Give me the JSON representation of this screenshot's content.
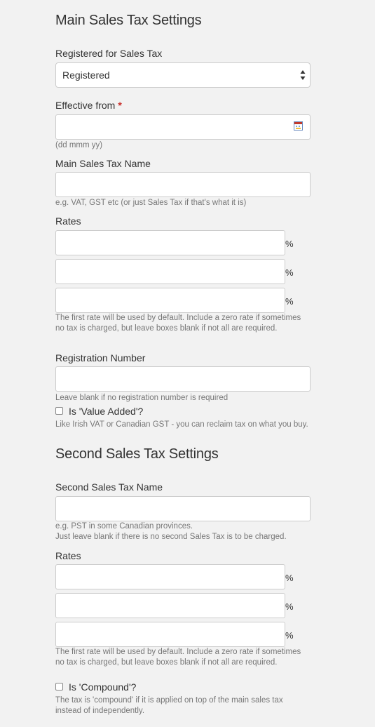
{
  "main": {
    "title": "Main Sales Tax Settings",
    "registered_label": "Registered for Sales Tax",
    "registered_value": "Registered",
    "effective_label": "Effective from",
    "effective_required": "*",
    "effective_value": "",
    "effective_help": "(dd mmm yy)",
    "name_label": "Main Sales Tax Name",
    "name_value": "",
    "name_help": "e.g. VAT, GST etc (or just Sales Tax if that's what it is)",
    "rates_label": "Rates",
    "rates": [
      "",
      "",
      ""
    ],
    "rate_unit": "%",
    "rates_help": "The first rate will be used by default. Include a zero rate if sometimes no tax is charged, but leave boxes blank if not all are required.",
    "regno_label": "Registration Number",
    "regno_value": "",
    "regno_help": "Leave blank if no registration number is required",
    "value_added_label": "Is 'Value Added'?",
    "value_added_checked": false,
    "value_added_help": "Like Irish VAT or Canadian GST - you can reclaim tax on what you buy."
  },
  "second": {
    "title": "Second Sales Tax Settings",
    "name_label": "Second Sales Tax Name",
    "name_value": "",
    "name_help_1": "e.g. PST in some Canadian provinces.",
    "name_help_2": "Just leave blank if there is no second Sales Tax is to be charged.",
    "rates_label": "Rates",
    "rates": [
      "",
      "",
      ""
    ],
    "rate_unit": "%",
    "rates_help": "The first rate will be used by default. Include a zero rate if sometimes no tax is charged, but leave boxes blank if not all are required.",
    "compound_label": "Is 'Compound'?",
    "compound_checked": false,
    "compound_help": "The tax is 'compound' if it is applied on top of the main sales tax instead of independently."
  },
  "icons": {
    "select_arrows": "up-down-arrows-icon",
    "date_picker": "calendar-icon"
  }
}
